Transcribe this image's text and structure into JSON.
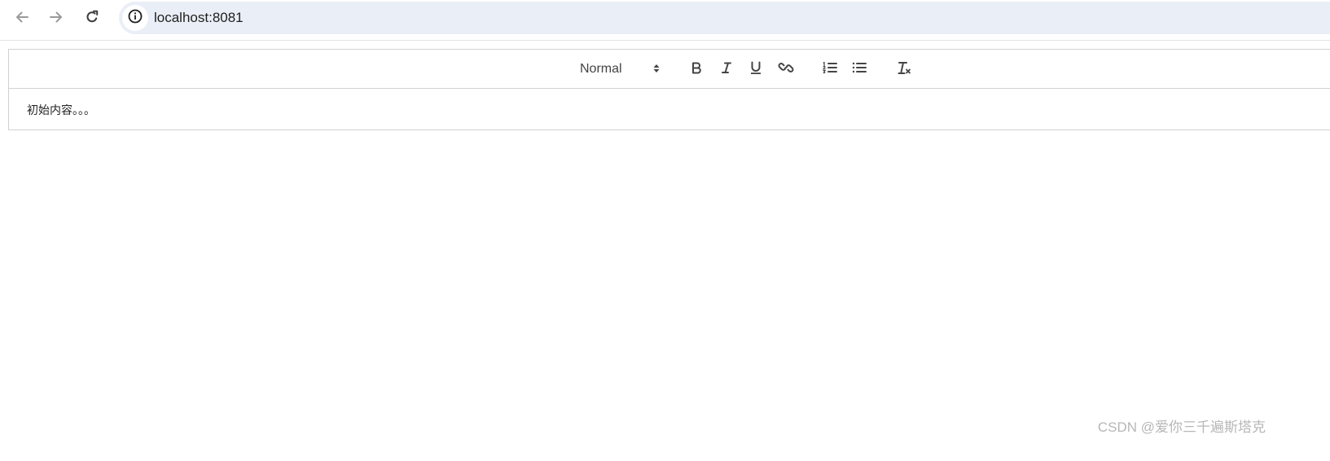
{
  "browser": {
    "back_icon": "arrow-left-icon",
    "forward_icon": "arrow-right-icon",
    "reload_icon": "reload-icon",
    "site_info_icon": "info-icon",
    "url": "localhost:8081"
  },
  "editor": {
    "toolbar": {
      "header_select": {
        "selected": "Normal",
        "icon": "updown-arrows-icon"
      },
      "buttons": [
        {
          "name": "bold",
          "icon": "bold-icon"
        },
        {
          "name": "italic",
          "icon": "italic-icon"
        },
        {
          "name": "underline",
          "icon": "underline-icon"
        },
        {
          "name": "link",
          "icon": "link-icon"
        },
        {
          "name": "ordered-list",
          "icon": "ordered-list-icon"
        },
        {
          "name": "bullet-list",
          "icon": "bullet-list-icon"
        },
        {
          "name": "clean",
          "icon": "clear-format-icon"
        }
      ]
    },
    "content": "初始内容。。。"
  },
  "watermark": "CSDN @爱你三千遍斯塔克",
  "colors": {
    "address_bar_bg": "#eaeef6",
    "toolbar_icon": "#444444",
    "border": "#d1d1d1"
  }
}
